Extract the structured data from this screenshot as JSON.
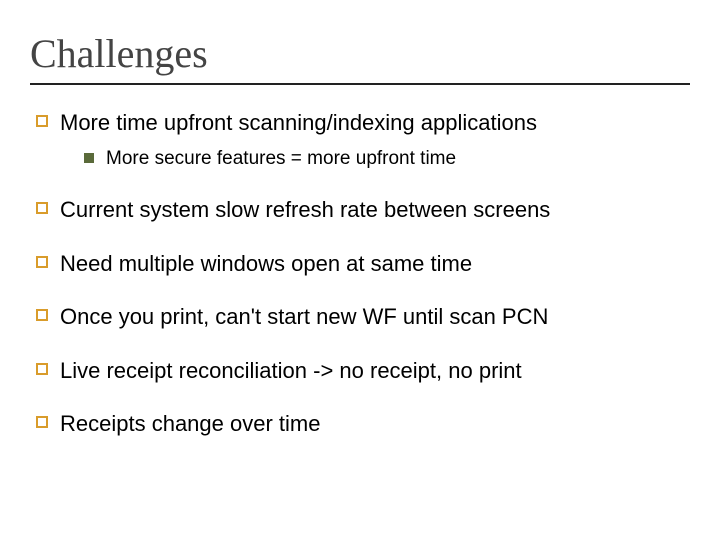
{
  "title": "Challenges",
  "items": [
    {
      "text": "More time upfront scanning/indexing applications",
      "sub": [
        {
          "text": "More secure features = more upfront time"
        }
      ]
    },
    {
      "text": "Current system slow refresh rate between screens"
    },
    {
      "text": "Need multiple windows open at same time"
    },
    {
      "text": "Once you print, can't start new WF until scan PCN"
    },
    {
      "text": "Live receipt reconciliation -> no receipt, no print"
    },
    {
      "text": "Receipts change over time"
    }
  ]
}
